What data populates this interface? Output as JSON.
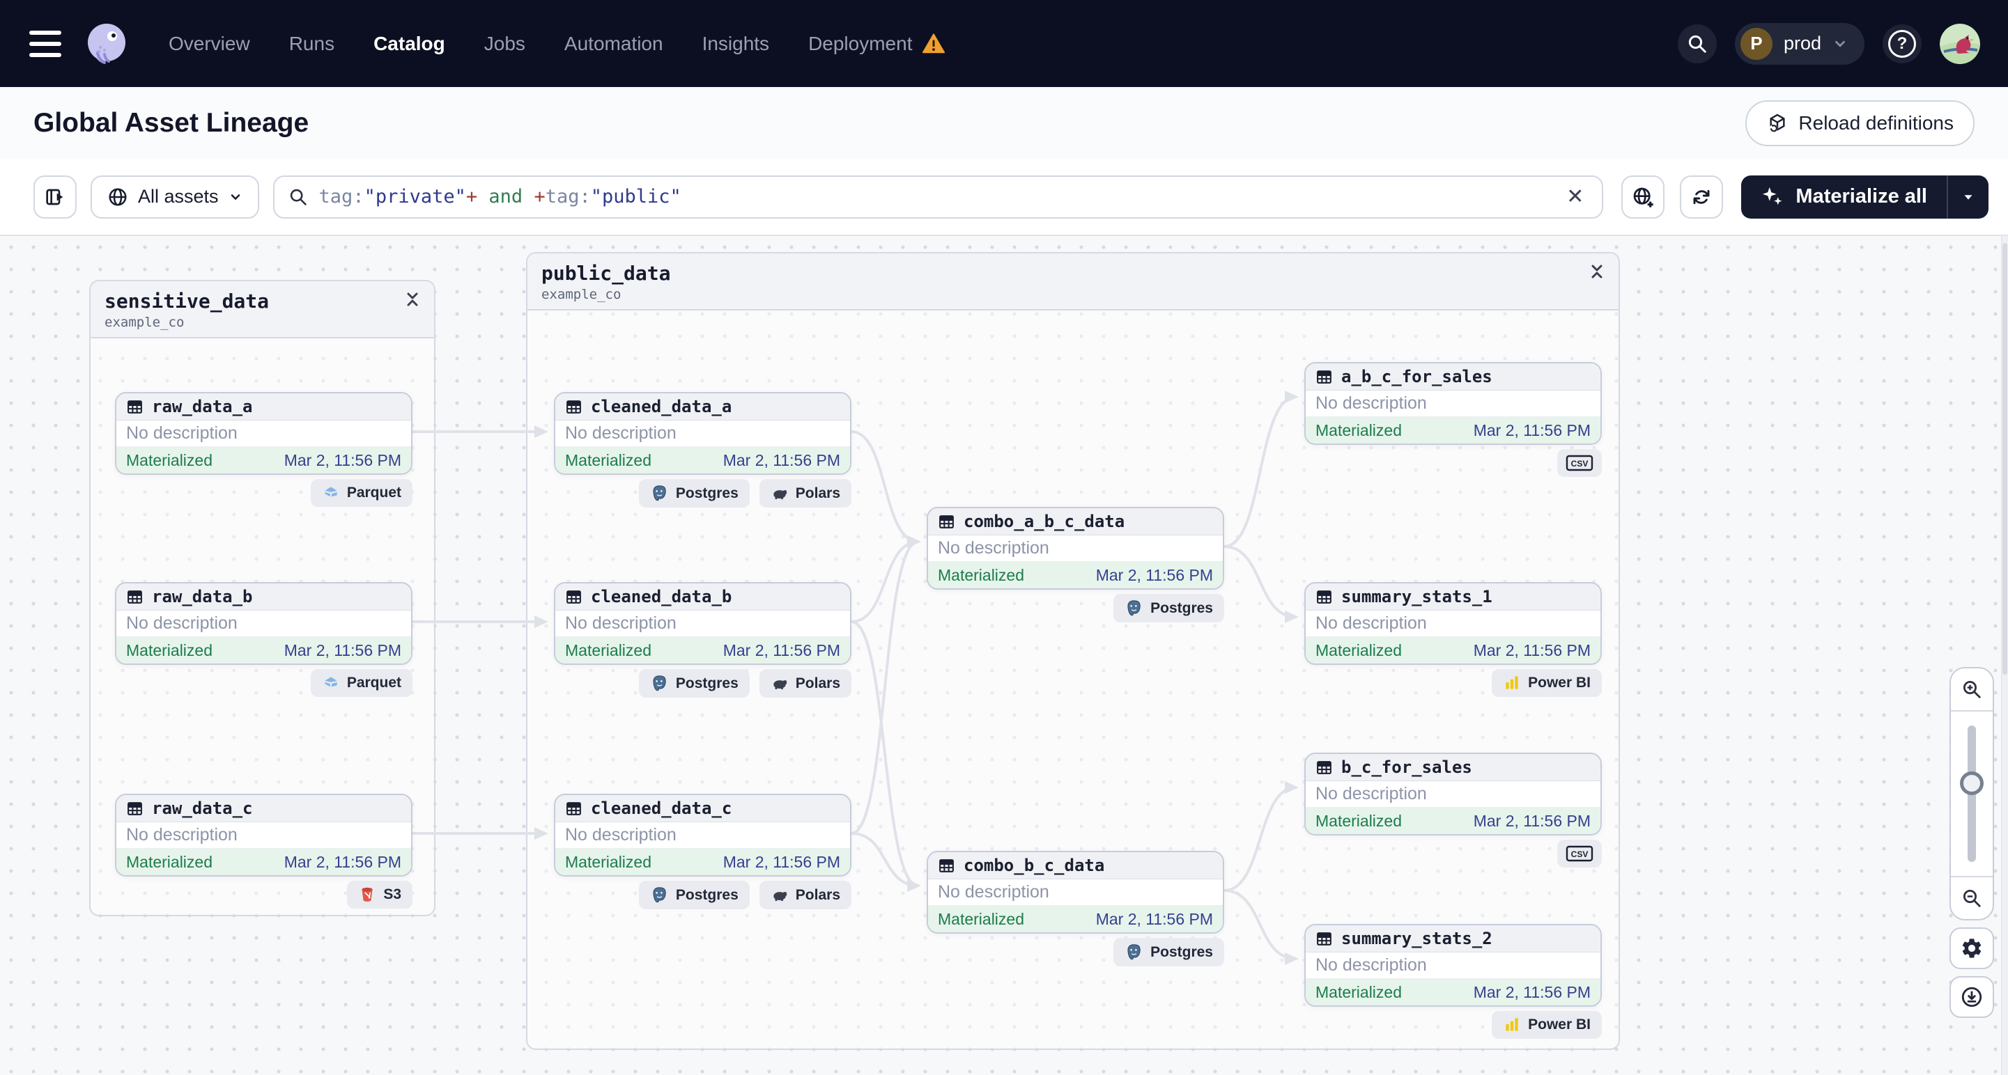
{
  "nav": {
    "items": [
      {
        "label": "Overview",
        "active": false,
        "warning": false
      },
      {
        "label": "Runs",
        "active": false,
        "warning": false
      },
      {
        "label": "Catalog",
        "active": true,
        "warning": false
      },
      {
        "label": "Jobs",
        "active": false,
        "warning": false
      },
      {
        "label": "Automation",
        "active": false,
        "warning": false
      },
      {
        "label": "Insights",
        "active": false,
        "warning": false
      },
      {
        "label": "Deployment",
        "active": false,
        "warning": true
      }
    ],
    "environment": {
      "initial": "P",
      "name": "prod"
    }
  },
  "header": {
    "title": "Global Asset Lineage",
    "reload_button": "Reload definitions"
  },
  "toolbar": {
    "scope_label": "All assets",
    "search_segments": [
      {
        "text": "tag:",
        "kind": "key"
      },
      {
        "text": "\"private\"",
        "kind": "string"
      },
      {
        "text": "+",
        "kind": "op"
      },
      {
        "text": " and ",
        "kind": "bool"
      },
      {
        "text": "+",
        "kind": "op"
      },
      {
        "text": "tag:",
        "kind": "key"
      },
      {
        "text": "\"public\"",
        "kind": "string"
      }
    ],
    "materialize_label": "Materialize all"
  },
  "graph": {
    "groups": [
      {
        "id": "sensitive_data",
        "name": "sensitive_data",
        "repo": "example_co"
      },
      {
        "id": "public_data",
        "name": "public_data",
        "repo": "example_co"
      }
    ],
    "nodes": [
      {
        "id": "raw_data_a",
        "name": "raw_data_a",
        "description": "No description",
        "status": "Materialized",
        "timestamp": "Mar 2, 11:56 PM",
        "tags": [
          {
            "label": "Parquet",
            "icon": "parquet"
          }
        ]
      },
      {
        "id": "raw_data_b",
        "name": "raw_data_b",
        "description": "No description",
        "status": "Materialized",
        "timestamp": "Mar 2, 11:56 PM",
        "tags": [
          {
            "label": "Parquet",
            "icon": "parquet"
          }
        ]
      },
      {
        "id": "raw_data_c",
        "name": "raw_data_c",
        "description": "No description",
        "status": "Materialized",
        "timestamp": "Mar 2, 11:56 PM",
        "tags": [
          {
            "label": "S3",
            "icon": "s3"
          }
        ]
      },
      {
        "id": "cleaned_data_a",
        "name": "cleaned_data_a",
        "description": "No description",
        "status": "Materialized",
        "timestamp": "Mar 2, 11:56 PM",
        "tags": [
          {
            "label": "Postgres",
            "icon": "postgres"
          },
          {
            "label": "Polars",
            "icon": "polars"
          }
        ]
      },
      {
        "id": "cleaned_data_b",
        "name": "cleaned_data_b",
        "description": "No description",
        "status": "Materialized",
        "timestamp": "Mar 2, 11:56 PM",
        "tags": [
          {
            "label": "Postgres",
            "icon": "postgres"
          },
          {
            "label": "Polars",
            "icon": "polars"
          }
        ]
      },
      {
        "id": "cleaned_data_c",
        "name": "cleaned_data_c",
        "description": "No description",
        "status": "Materialized",
        "timestamp": "Mar 2, 11:56 PM",
        "tags": [
          {
            "label": "Postgres",
            "icon": "postgres"
          },
          {
            "label": "Polars",
            "icon": "polars"
          }
        ]
      },
      {
        "id": "combo_a_b_c_data",
        "name": "combo_a_b_c_data",
        "description": "No description",
        "status": "Materialized",
        "timestamp": "Mar 2, 11:56 PM",
        "tags": [
          {
            "label": "Postgres",
            "icon": "postgres"
          }
        ]
      },
      {
        "id": "combo_b_c_data",
        "name": "combo_b_c_data",
        "description": "No description",
        "status": "Materialized",
        "timestamp": "Mar 2, 11:56 PM",
        "tags": [
          {
            "label": "Postgres",
            "icon": "postgres"
          }
        ]
      },
      {
        "id": "a_b_c_for_sales",
        "name": "a_b_c_for_sales",
        "description": "No description",
        "status": "Materialized",
        "timestamp": "Mar 2, 11:56 PM",
        "tags": [
          {
            "label": "",
            "icon": "csv"
          }
        ]
      },
      {
        "id": "summary_stats_1",
        "name": "summary_stats_1",
        "description": "No description",
        "status": "Materialized",
        "timestamp": "Mar 2, 11:56 PM",
        "tags": [
          {
            "label": "Power BI",
            "icon": "powerbi"
          }
        ]
      },
      {
        "id": "b_c_for_sales",
        "name": "b_c_for_sales",
        "description": "No description",
        "status": "Materialized",
        "timestamp": "Mar 2, 11:56 PM",
        "tags": [
          {
            "label": "",
            "icon": "csv"
          }
        ]
      },
      {
        "id": "summary_stats_2",
        "name": "summary_stats_2",
        "description": "No description",
        "status": "Materialized",
        "timestamp": "Mar 2, 11:56 PM",
        "tags": [
          {
            "label": "Power BI",
            "icon": "powerbi"
          }
        ]
      }
    ],
    "edges": [
      [
        "raw_data_a",
        "cleaned_data_a"
      ],
      [
        "raw_data_b",
        "cleaned_data_b"
      ],
      [
        "raw_data_c",
        "cleaned_data_c"
      ],
      [
        "cleaned_data_a",
        "combo_a_b_c_data"
      ],
      [
        "cleaned_data_b",
        "combo_a_b_c_data"
      ],
      [
        "cleaned_data_c",
        "combo_a_b_c_data"
      ],
      [
        "cleaned_data_b",
        "combo_b_c_data"
      ],
      [
        "cleaned_data_c",
        "combo_b_c_data"
      ],
      [
        "combo_a_b_c_data",
        "a_b_c_for_sales"
      ],
      [
        "combo_a_b_c_data",
        "summary_stats_1"
      ],
      [
        "combo_b_c_data",
        "b_c_for_sales"
      ],
      [
        "combo_b_c_data",
        "summary_stats_2"
      ]
    ]
  },
  "colors": {
    "nav_bg": "#0c0f22",
    "accent_dark": "#151a2e",
    "materialized_green": "#1d7c4c",
    "timestamp_indigo": "#36408f",
    "warning_orange": "#f0a030",
    "edge_gray": "#e0e2e9"
  }
}
